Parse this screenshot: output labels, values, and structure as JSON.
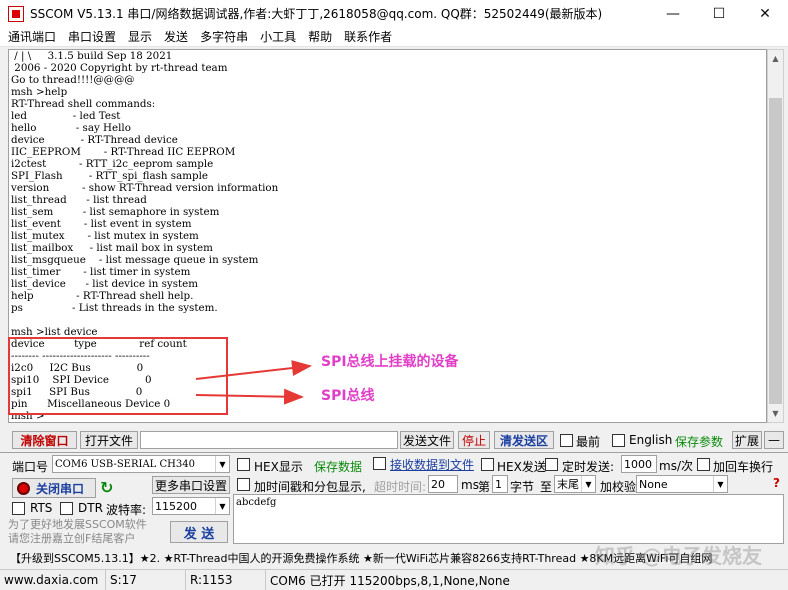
{
  "title_bar": {
    "title": "SSCOM V5.13.1 串口/网络数据调试器,作者:大虾丁丁,2618058@qq.com. QQ群：52502449(最新版本)",
    "minimize": "—",
    "maximize": "☐",
    "close": "✕"
  },
  "menu": [
    "通讯端口",
    "串口设置",
    "显示",
    "发送",
    "多字符串",
    "小工具",
    "帮助",
    "联系作者"
  ],
  "terminal": {
    "lines": [
      " / | \\     3.1.5 build Sep 18 2021",
      " 2006 - 2020 Copyright by rt-thread team",
      "Go to thread!!!!@@@@",
      "msh >help",
      "RT-Thread shell commands:",
      "led              - led Test",
      "hello            - say Hello",
      "device           - RT-Thread device",
      "IIC_EEPROM       - RT-Thread IIC EEPROM",
      "i2ctest          - RTT_i2c_eeprom sample",
      "SPI_Flash        - RTT_spi_flash sample",
      "version          - show RT-Thread version information",
      "list_thread      - list thread",
      "list_sem         - list semaphore in system",
      "list_event       - list event in system",
      "list_mutex       - list mutex in system",
      "list_mailbox     - list mail box in system",
      "list_msgqueue    - list message queue in system",
      "list_timer       - list timer in system",
      "list_device      - list device in system",
      "help             - RT-Thread shell help.",
      "ps               - List threads in the system.",
      "",
      "msh >list device",
      "device         type             ref count",
      "-------- -------------------- ----------",
      "i2c0     I2C Bus              0",
      "spi10    SPI Device           0",
      "spi1     SPI Bus              0",
      "pin      Miscellaneous Device 0",
      "msh >"
    ]
  },
  "annotations": {
    "label1": "SPI总线上挂载的设备",
    "label2": "SPI总线"
  },
  "controls": {
    "clear_window": "清除窗口",
    "open_file": "打开文件",
    "send_file": "发送文件",
    "stop": "停止",
    "clear_send": "清发送区",
    "front": "最前",
    "english": "English",
    "save_params": "保存参数",
    "expand": "扩展",
    "collapse": "—",
    "port_label": "端口号",
    "port_value": "COM6 USB-SERIAL CH340",
    "hex_display": "HEX显示",
    "save_data": "保存数据",
    "recv_to_file": "接收数据到文件",
    "hex_send": "HEX发送",
    "timed_send": "定时发送:",
    "interval": "1000",
    "interval_unit": "ms/次",
    "add_crlf": "加回车换行",
    "close_port": "关闭串口",
    "more_settings": "更多串口设置",
    "timestamp": "加时间戳和分包显示,",
    "timeout_label": "超时时间:",
    "timeout_value": "20",
    "ms": "ms",
    "byte_label": "第",
    "byte_value": "1",
    "byte_unit": "字节",
    "to": "至",
    "end_value": "末尾",
    "checksum_label": "加校验",
    "checksum_value": "None",
    "rts": "RTS",
    "dtr": "DTR",
    "baud_label": "波特率:",
    "baud_value": "115200",
    "send_text": "abcdefg",
    "promo": "为了更好地发展SSCOM软件\n请您注册嘉立创F结尾客户",
    "send_button": "发  送",
    "help_mark": "?"
  },
  "ticker": "【升级到SSCOM5.13.1】★2. ★RT-Thread中国人的开源免费操作系统 ★新一代WiFi芯片兼容8266支持RT-Thread ★8KM远距离WiFi可自组网",
  "watermark": "知乎 @电子发烧友",
  "status": {
    "site": "www.daxia.com",
    "sent": "S:17",
    "received": "R:1153",
    "port_info": "COM6 已打开  115200bps,8,1,None,None"
  },
  "colors": {
    "annotation_red": "#e53935",
    "annotation_text": "#e040c8",
    "green": "#0a8a0a"
  }
}
